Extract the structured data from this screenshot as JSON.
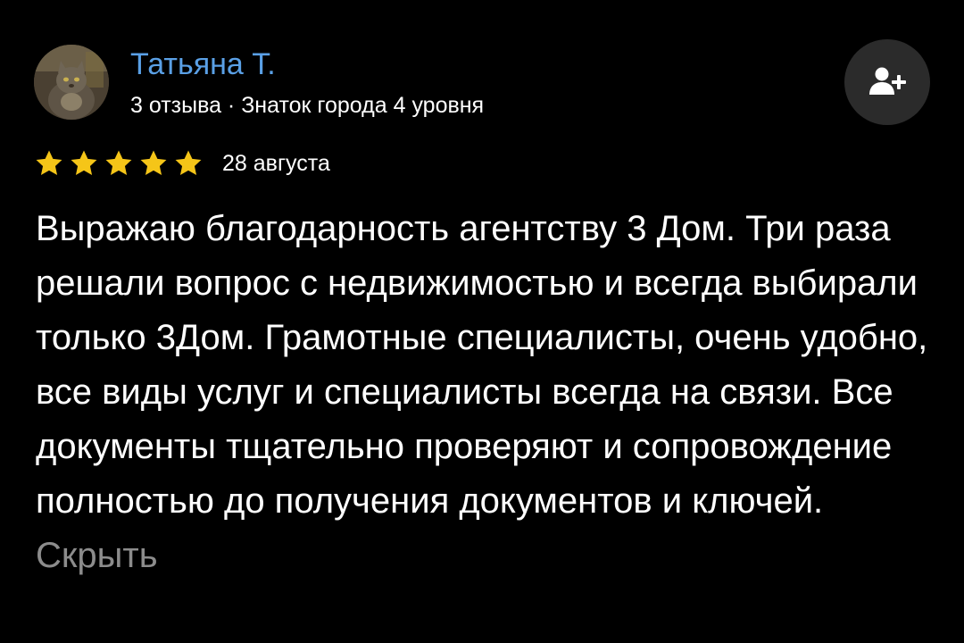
{
  "author": {
    "name": "Татьяна Т.",
    "meta": "3 отзыва · Знаток города 4 уровня"
  },
  "subscribe": {
    "icon": "add-person-icon"
  },
  "rating": {
    "stars": 5,
    "max": 5,
    "color": "#f5c518"
  },
  "review": {
    "date": "28 августа",
    "text": "Выражаю благодарность агентству 3 Дом. Три раза решали вопрос с недвижимостью и всегда выбирали только 3Дом. Грамотные специалисты, очень удобно, все виды услуг и специалисты всегда на связи. Все документы тщательно проверяют и сопровождение полностью до получения документов и ключей.",
    "hide_label": "Скрыть"
  },
  "colors": {
    "background": "#000000",
    "author_name": "#5aa0e6",
    "hide_link": "#8c8c8c",
    "button_bg": "#2b2b2b"
  }
}
